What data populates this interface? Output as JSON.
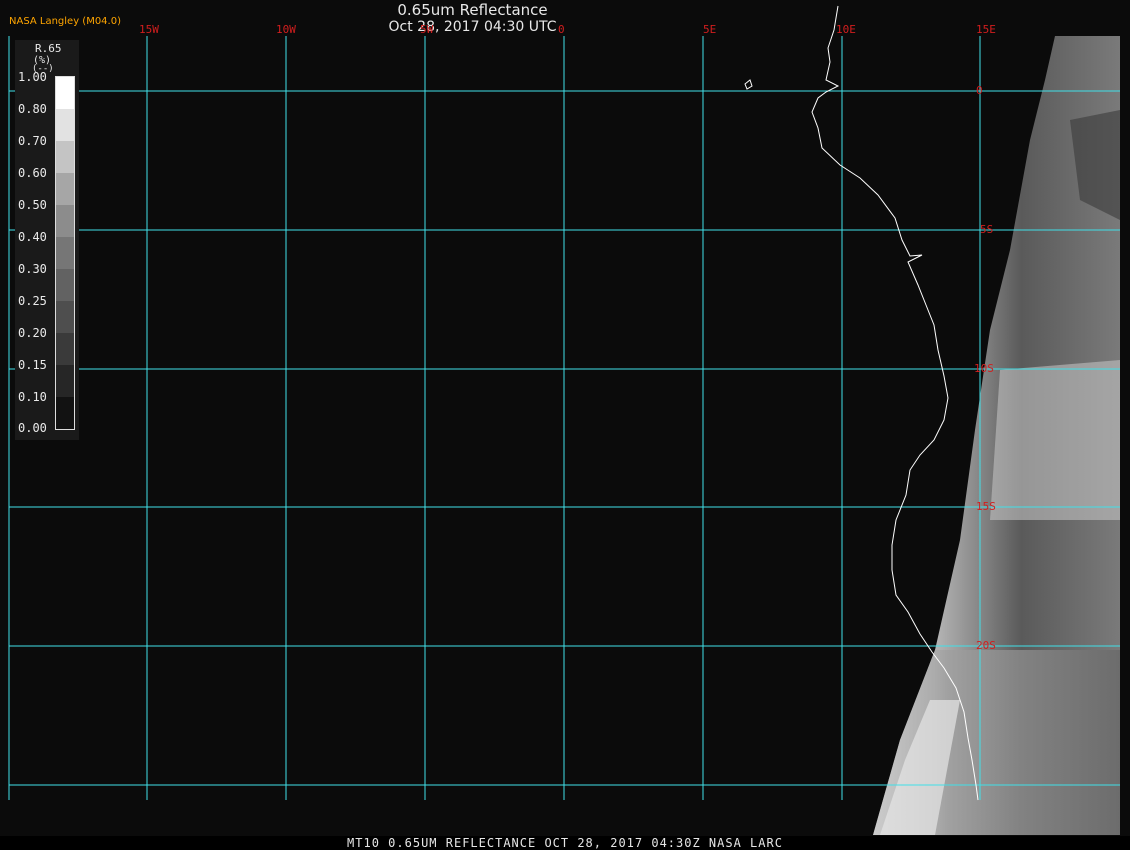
{
  "header": {
    "agency": "NASA Langley (M04.0)",
    "title": "0.65um Reflectance",
    "datetime": "Oct 28, 2017 04:30 UTC"
  },
  "map": {
    "background_color": "#0b0b0b",
    "grid_color": "#40e0e8",
    "coast_color": "#ffffff",
    "label_color": "#d21e1e",
    "longitude_labels": [
      "15W",
      "10W",
      "5W",
      "0",
      "5E",
      "10E",
      "15E"
    ],
    "latitude_labels": [
      "0",
      "5S",
      "10S",
      "15S",
      "20S"
    ]
  },
  "legend": {
    "parameter": "R.65",
    "unit_line1": "(%)",
    "unit_line2": "(--)",
    "ticks": [
      "1.00",
      "0.80",
      "0.70",
      "0.60",
      "0.50",
      "0.40",
      "0.30",
      "0.25",
      "0.20",
      "0.15",
      "0.10",
      "0.00"
    ]
  },
  "footer": {
    "caption": "MT10  0.65UM REFLECTANCE  OCT 28, 2017 04:30Z  NASA LARC"
  }
}
